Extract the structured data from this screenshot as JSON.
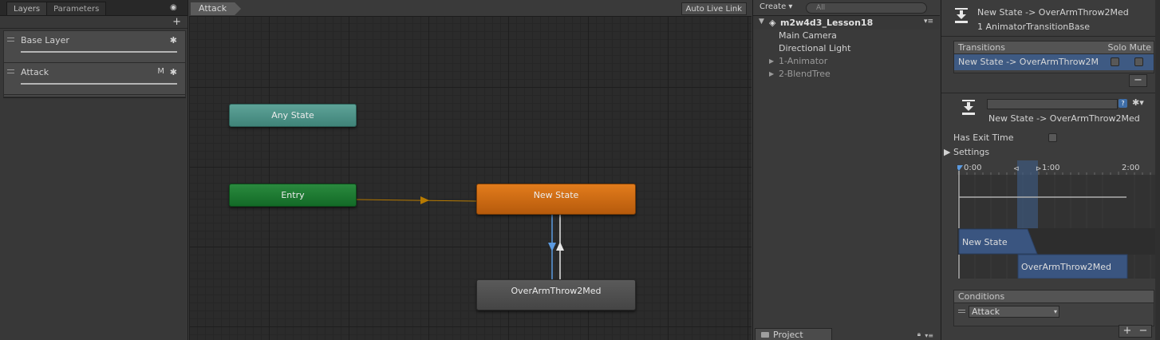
{
  "layers_panel": {
    "tabs": [
      "Layers",
      "Parameters"
    ],
    "layers": [
      {
        "name": "Base Layer",
        "flag": ""
      },
      {
        "name": "Attack",
        "flag": "M"
      }
    ]
  },
  "graph": {
    "breadcrumb": "Attack",
    "auto_live_link": "Auto Live Link",
    "nodes": {
      "any_state": "Any State",
      "entry": "Entry",
      "new_state": "New State",
      "over_arm": "OverArmThrow2Med"
    },
    "colors": {
      "any_state": "#4f9388",
      "entry": "#1d7a33",
      "new_state": "#cc6a14",
      "state": "#4f4f4f",
      "entry_link": "#b77a00",
      "transition": "#5b9ae0",
      "transition_back": "#e6e6e6"
    }
  },
  "hierarchy": {
    "create_label": "Create",
    "search_placeholder": "All",
    "scene_name": "m2w4d3_Lesson18",
    "items": [
      {
        "label": "Main Camera",
        "foldable": false
      },
      {
        "label": "Directional Light",
        "foldable": false
      },
      {
        "label": "1-Animator",
        "foldable": true
      },
      {
        "label": "2-BlendTree",
        "foldable": true
      }
    ],
    "project_tab": "Project"
  },
  "inspector": {
    "title": "New State -> OverArmThrow2Med",
    "subtitle": "1 AnimatorTransitionBase",
    "transitions_header": "Transitions",
    "solo_label": "Solo",
    "mute_label": "Mute",
    "transition_row": "New State -> OverArmThrow2M",
    "detail_label": "New State -> OverArmThrow2Med",
    "has_exit_time_label": "Has Exit Time",
    "settings_label": "Settings",
    "timeline": {
      "ticks": [
        "0:00",
        "1:00",
        "2:00"
      ],
      "source_clip": "New State",
      "dest_clip": "OverArmThrow2Med"
    },
    "conditions_header": "Conditions",
    "condition_param": "Attack"
  }
}
